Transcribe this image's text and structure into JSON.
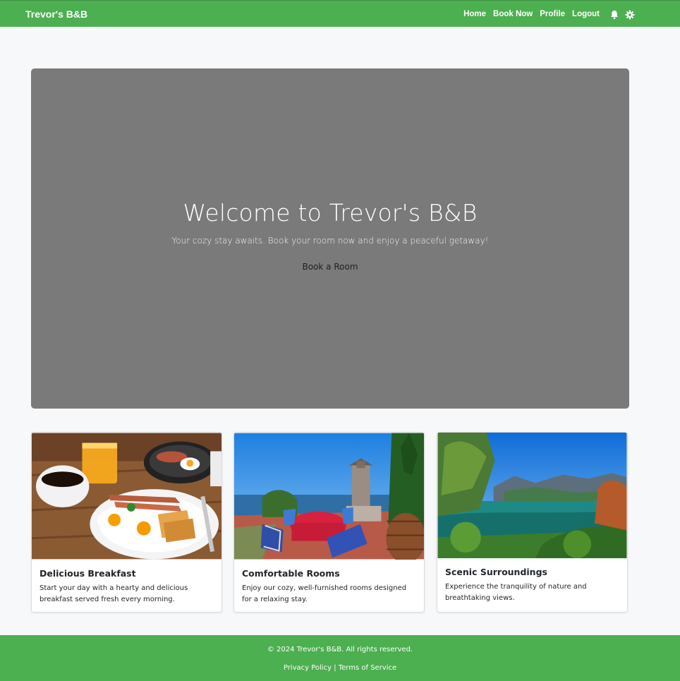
{
  "navbar": {
    "brand": "Trevor's B&B",
    "links": [
      "Home",
      "Book Now",
      "Profile",
      "Logout"
    ],
    "icons": [
      "bell-icon",
      "gear-icon"
    ]
  },
  "hero": {
    "title": "Welcome to Trevor's B&B",
    "subtitle": "Your cozy stay awaits. Book your room now and enjoy a peaceful getaway!",
    "button": "Book a Room",
    "background": "#7a7a7a"
  },
  "cards": [
    {
      "title": "Delicious Breakfast",
      "text": "Start your day with a hearty and delicious breakfast served fresh every morning."
    },
    {
      "title": "Comfortable Rooms",
      "text": "Enjoy our cozy, well-furnished rooms designed for a relaxing stay."
    },
    {
      "title": "Scenic Surroundings",
      "text": "Experience the tranquility of nature and breathtaking views."
    }
  ],
  "footer": {
    "copyright": "© 2024 Trevor's B&B. All rights reserved.",
    "privacy": "Privacy Policy",
    "separator": "|",
    "terms": "Terms of Service"
  },
  "colors": {
    "brand_green": "#4caf50",
    "page_background": "#f7f8fa"
  }
}
